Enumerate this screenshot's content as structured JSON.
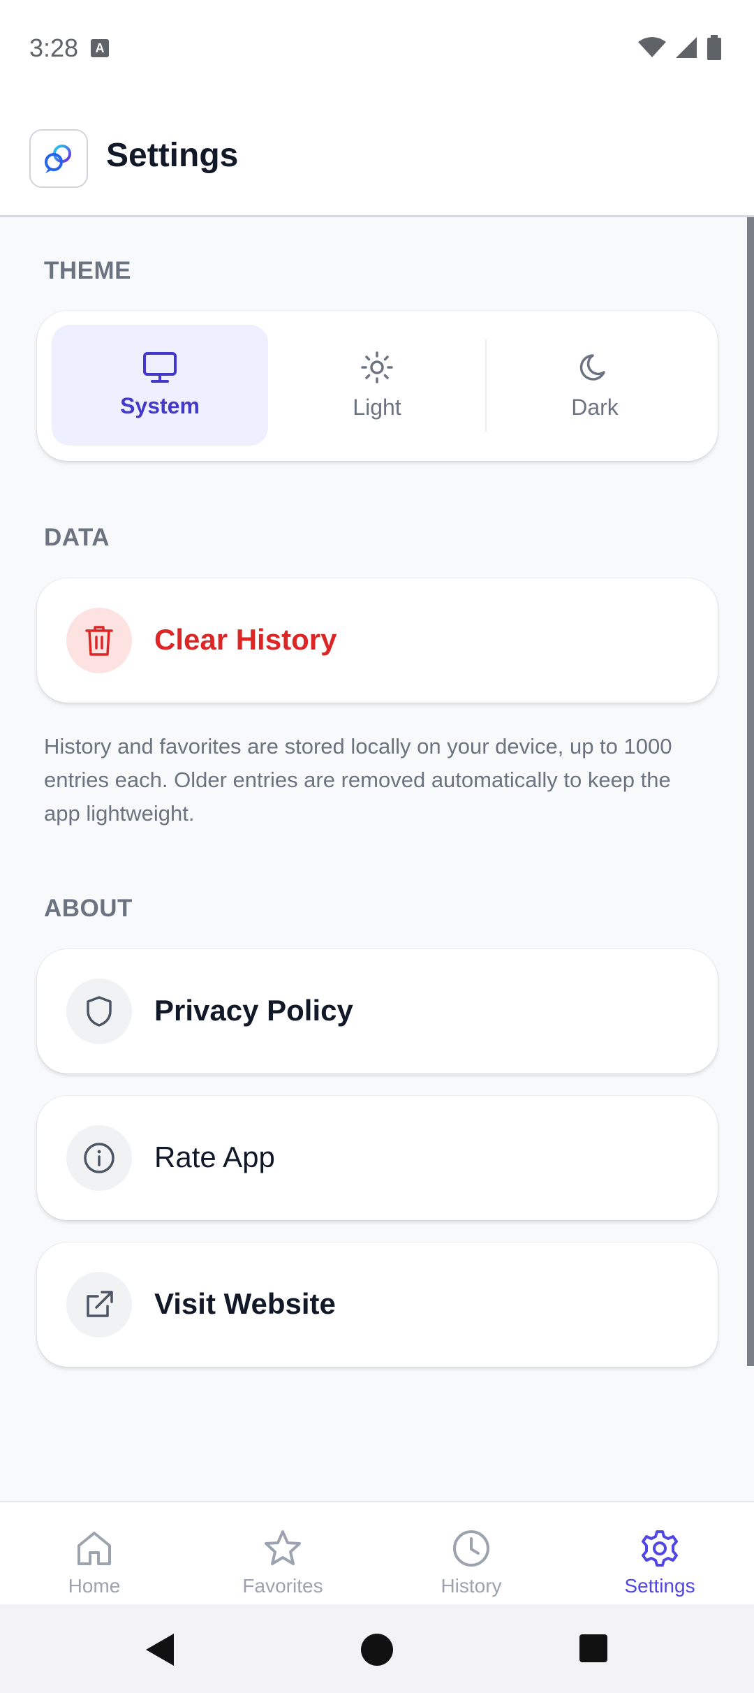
{
  "status_bar": {
    "time": "3:28",
    "notification_glyph": "A"
  },
  "header": {
    "title": "Settings",
    "logo_icon": "chat-bubbles-logo-icon"
  },
  "sections": {
    "theme": {
      "label": "THEME",
      "options": [
        {
          "label": "System",
          "icon": "monitor-icon",
          "selected": true
        },
        {
          "label": "Light",
          "icon": "sun-icon",
          "selected": false
        },
        {
          "label": "Dark",
          "icon": "moon-icon",
          "selected": false
        }
      ]
    },
    "data": {
      "label": "DATA",
      "clear_history": "Clear History",
      "info": "History and favorites are stored locally on your device, up to 1000 entries each. Older entries are removed automatically to keep the app lightweight."
    },
    "about": {
      "label": "ABOUT",
      "items": [
        {
          "label": "Privacy Policy",
          "icon": "shield-icon"
        },
        {
          "label": "Rate App",
          "icon": "info-icon"
        },
        {
          "label": "Visit Website",
          "icon": "external-link-icon"
        }
      ]
    }
  },
  "bottom_nav": {
    "items": [
      {
        "label": "Home",
        "icon": "home-icon",
        "active": false
      },
      {
        "label": "Favorites",
        "icon": "star-icon",
        "active": false
      },
      {
        "label": "History",
        "icon": "clock-icon",
        "active": false
      },
      {
        "label": "Settings",
        "icon": "gear-icon",
        "active": true
      }
    ]
  },
  "colors": {
    "accent": "#4f46e5",
    "danger": "#dc2626",
    "muted": "#6b7280",
    "background": "#f8f9fb"
  }
}
